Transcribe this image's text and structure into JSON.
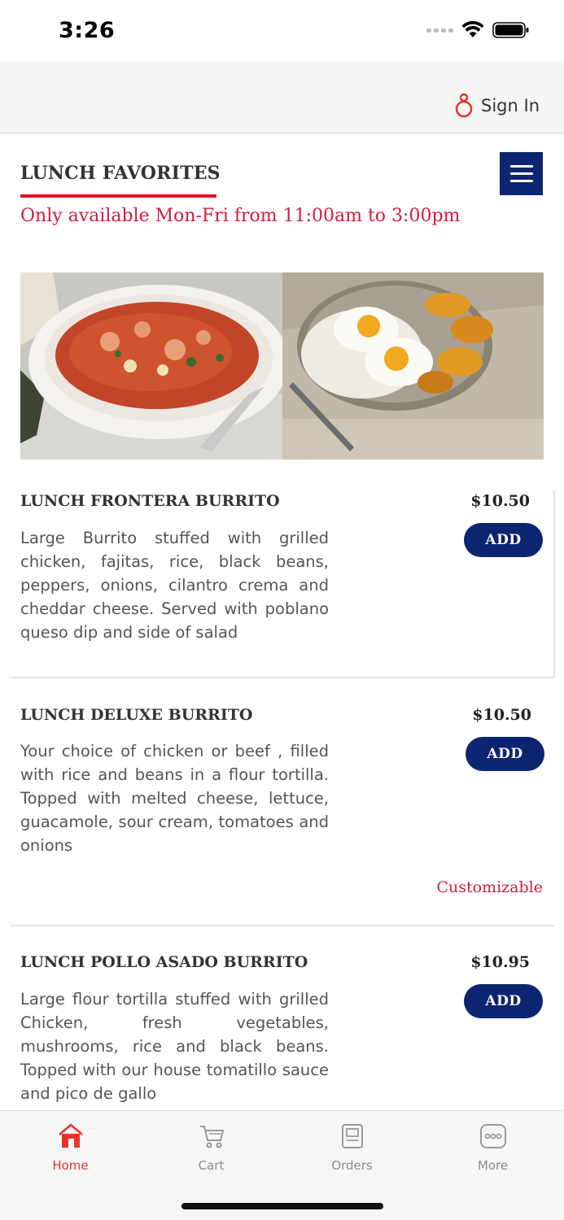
{
  "status_bar": {
    "time": "3:26"
  },
  "header": {
    "sign_in_label": "Sign In"
  },
  "section": {
    "title": "LUNCH FAVORITES",
    "availability": "Only available Mon-Fri from 11:00am to 3:00pm"
  },
  "items": [
    {
      "name": "LUNCH FRONTERA BURRITO",
      "price": "$10.50",
      "description": "Large Burrito stuffed with grilled chicken, fajitas, rice, black beans, peppers, onions, cilantro crema and cheddar cheese. Served with poblano queso dip and side of salad",
      "add_label": "ADD"
    },
    {
      "name": "LUNCH DELUXE BURRITO",
      "price": "$10.50",
      "description": "Your choice of chicken or beef , filled with rice and beans in a flour tortilla. Topped with melted cheese, lettuce, guacamole, sour cream, tomatoes and onions",
      "add_label": "ADD",
      "tag": "Customizable"
    },
    {
      "name": "LUNCH POLLO ASADO BURRITO",
      "price": "$10.95",
      "description": "Large flour tortilla stuffed with grilled Chicken, fresh vegetables, mushrooms, rice and black beans. Topped with our house tomatillo sauce and pico de gallo",
      "add_label": "ADD"
    }
  ],
  "tab_bar": {
    "tabs": [
      {
        "label": "Home",
        "icon": "home-icon",
        "active": true
      },
      {
        "label": "Cart",
        "icon": "cart-icon",
        "active": false
      },
      {
        "label": "Orders",
        "icon": "orders-icon",
        "active": false
      },
      {
        "label": "More",
        "icon": "more-icon",
        "active": false
      }
    ]
  },
  "colors": {
    "primary_navy": "#0d2570",
    "accent_red": "#e8131f",
    "availability_red": "#d31c3f",
    "active_tab": "#e8322a"
  }
}
